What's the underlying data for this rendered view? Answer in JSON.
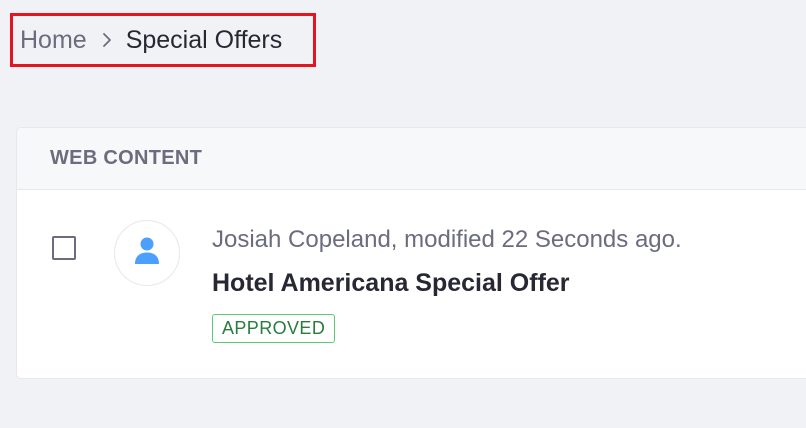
{
  "breadcrumb": {
    "home": "Home",
    "current": "Special Offers"
  },
  "panel": {
    "title": "WEB CONTENT",
    "row": {
      "meta": "Josiah Copeland, modified 22 Seconds ago.",
      "title": "Hotel Americana Special Offer",
      "status": "APPROVED"
    }
  },
  "colors": {
    "highlight": "#e5141f",
    "avatar_icon": "#4b9fff",
    "status_border": "#5aca75",
    "status_text": "#287d3c"
  },
  "icons": {
    "separator": "chevron-right-icon",
    "avatar": "user-icon"
  }
}
